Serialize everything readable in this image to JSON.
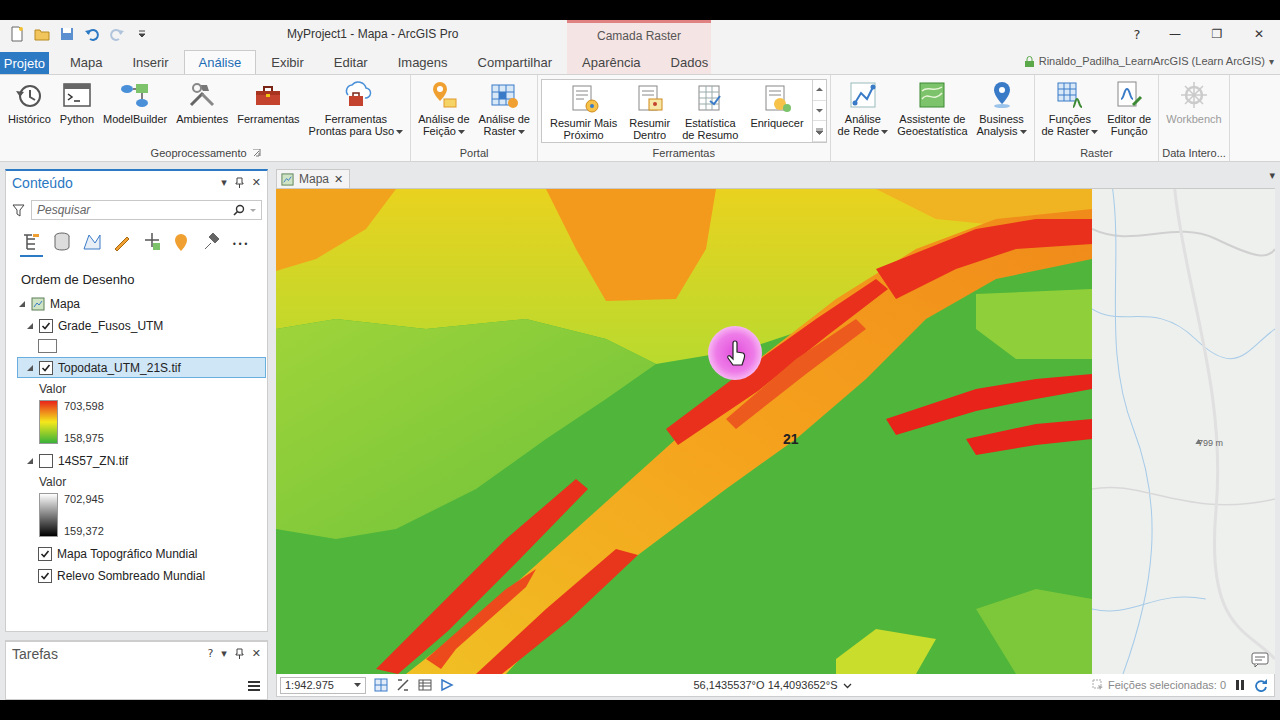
{
  "window": {
    "title": "MyProject1 - Mapa - ArcGIS Pro",
    "contextual_group": "Camada Raster",
    "help": "?",
    "controls": [
      "—",
      "❐",
      "✕"
    ]
  },
  "ribbon_tabs": [
    {
      "label": "Projeto",
      "selected": false,
      "kind": "file"
    },
    {
      "label": "Mapa",
      "selected": false,
      "kind": "normal"
    },
    {
      "label": "Inserir",
      "selected": false,
      "kind": "normal"
    },
    {
      "label": "Análise",
      "selected": true,
      "kind": "normal"
    },
    {
      "label": "Exibir",
      "selected": false,
      "kind": "normal"
    },
    {
      "label": "Editar",
      "selected": false,
      "kind": "normal"
    },
    {
      "label": "Imagens",
      "selected": false,
      "kind": "normal"
    },
    {
      "label": "Compartilhar",
      "selected": false,
      "kind": "normal"
    },
    {
      "label": "Aparência",
      "selected": false,
      "kind": "contextual"
    },
    {
      "label": "Dados",
      "selected": false,
      "kind": "contextual"
    }
  ],
  "user": {
    "name": "Rinaldo_Padilha_LearnArcGIS (Learn ArcGIS)",
    "menu": "▾"
  },
  "ribbon_groups": [
    {
      "label": "Geoprocessamento",
      "kind": "buttons",
      "launcher": true,
      "buttons": [
        {
          "lines": [
            "Histórico"
          ],
          "dropdown": false,
          "disabled": false
        },
        {
          "lines": [
            "Python"
          ],
          "dropdown": false,
          "disabled": false
        },
        {
          "lines": [
            "ModelBuilder"
          ],
          "dropdown": false,
          "disabled": false
        },
        {
          "lines": [
            "Ambientes"
          ],
          "dropdown": false,
          "disabled": false
        },
        {
          "lines": [
            "Ferramentas"
          ],
          "dropdown": false,
          "disabled": false
        },
        {
          "lines": [
            "Ferramentas",
            "Prontas para Uso"
          ],
          "dropdown": true,
          "disabled": false
        }
      ]
    },
    {
      "label": "Portal",
      "kind": "buttons",
      "launcher": false,
      "buttons": [
        {
          "lines": [
            "Análise de",
            "Feição"
          ],
          "dropdown": true,
          "disabled": false
        },
        {
          "lines": [
            "Análise de",
            "Raster"
          ],
          "dropdown": true,
          "disabled": false
        }
      ]
    },
    {
      "label": "Ferramentas",
      "kind": "gallery",
      "launcher": false,
      "buttons": [
        {
          "lines": [
            "Resumir Mais",
            "Próximo"
          ],
          "dropdown": false,
          "disabled": false
        },
        {
          "lines": [
            "Resumir",
            "Dentro"
          ],
          "dropdown": false,
          "disabled": false
        },
        {
          "lines": [
            "Estatística",
            "de Resumo"
          ],
          "dropdown": false,
          "disabled": false
        },
        {
          "lines": [
            "Enriquecer"
          ],
          "dropdown": false,
          "disabled": false
        }
      ]
    },
    {
      "label": "",
      "kind": "buttons",
      "launcher": false,
      "buttons": [
        {
          "lines": [
            "Análise",
            "de Rede"
          ],
          "dropdown": true,
          "disabled": false
        },
        {
          "lines": [
            "Assistente de",
            "Geoestatística"
          ],
          "dropdown": false,
          "disabled": false
        },
        {
          "lines": [
            "Business",
            "Analysis"
          ],
          "dropdown": true,
          "disabled": false
        }
      ]
    },
    {
      "label": "Raster",
      "kind": "buttons",
      "launcher": false,
      "buttons": [
        {
          "lines": [
            "Funções",
            "de Raster"
          ],
          "dropdown": true,
          "disabled": false
        },
        {
          "lines": [
            "Editor de",
            "Função"
          ],
          "dropdown": false,
          "disabled": false
        }
      ]
    },
    {
      "label": "Data Intero...",
      "kind": "buttons",
      "launcher": false,
      "buttons": [
        {
          "lines": [
            "Workbench"
          ],
          "dropdown": false,
          "disabled": true
        }
      ]
    }
  ],
  "contents": {
    "title": "Conteúdo",
    "menu": "▾",
    "close": "✕",
    "search_placeholder": "Pesquisar",
    "more": "•••",
    "tools": [
      {
        "selected": true
      },
      {
        "selected": false
      },
      {
        "selected": false
      },
      {
        "selected": false
      },
      {
        "selected": false
      },
      {
        "selected": false
      },
      {
        "selected": false
      }
    ],
    "section": "Ordem de Desenho",
    "layers": [
      {
        "kind": "map",
        "name": "Mapa",
        "expanded": true,
        "checked": false,
        "selected": false
      },
      {
        "kind": "layer",
        "name": "Grade_Fusos_UTM",
        "expanded": true,
        "checked": true,
        "selected": false,
        "legend": {
          "kind": "fill"
        }
      },
      {
        "kind": "layer",
        "name": "Topodata_UTM_21S.tif",
        "expanded": true,
        "checked": true,
        "selected": true,
        "legend": {
          "kind": "ramp",
          "field": "Valor",
          "high": "703,598",
          "low": "158,975",
          "colors": [
            "#e8231a",
            "#f4e81c",
            "#37b23a"
          ]
        }
      },
      {
        "kind": "layer",
        "name": "14S57_ZN.tif",
        "expanded": true,
        "checked": false,
        "selected": false,
        "legend": {
          "kind": "ramp",
          "field": "Valor",
          "high": "702,945",
          "low": "159,372",
          "colors": [
            "#ffffff",
            "#000000"
          ]
        }
      },
      {
        "kind": "basemap",
        "name": "Mapa Topográfico Mundial",
        "expanded": false,
        "checked": true,
        "selected": false
      },
      {
        "kind": "basemap",
        "name": "Relevo Sombreado Mundial",
        "expanded": false,
        "checked": true,
        "selected": false
      }
    ]
  },
  "tasks": {
    "title": "Tarefas",
    "help": "?",
    "menu": "▾",
    "close": "✕"
  },
  "map": {
    "tab": {
      "label": "Mapa",
      "close": "✕",
      "selected": true
    },
    "strip_menu": "▾",
    "labels": [
      {
        "text": "21",
        "kind": "zone"
      },
      {
        "text": "799 m",
        "kind": "elevation"
      }
    ]
  },
  "status_bar": {
    "scale": "1:942.975",
    "coordinates": "56,1435537°O 14,4093652°S",
    "selected_features": "Feições selecionadas: 0"
  }
}
